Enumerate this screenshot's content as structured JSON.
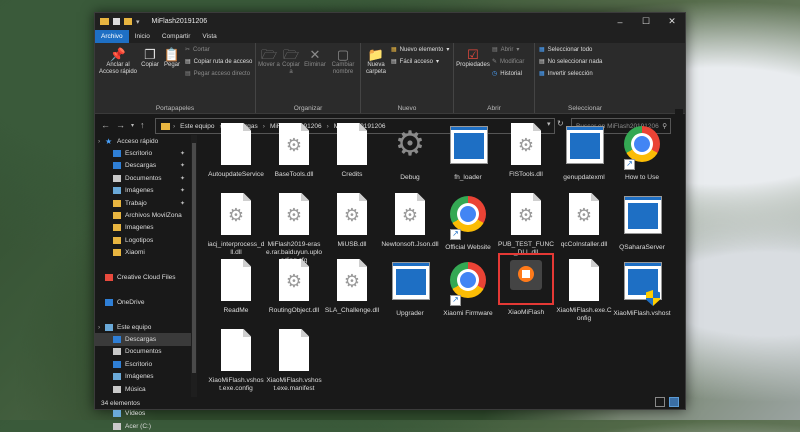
{
  "window": {
    "title": "MiFlash20191206"
  },
  "tabs": [
    "Archivo",
    "Inicio",
    "Compartir",
    "Vista"
  ],
  "ribbon": {
    "portapapeles": {
      "label": "Portapapeles",
      "anclar": "Anclar al Acceso rápido",
      "copiar": "Copiar",
      "pegar": "Pegar",
      "cortar": "Cortar",
      "copiar_ruta": "Copiar ruta de acceso",
      "pegar_acceso": "Pegar acceso directo"
    },
    "organizar": {
      "label": "Organizar",
      "mover": "Mover a",
      "copiar_a": "Copiar a",
      "eliminar": "Eliminar",
      "cambiar_nombre": "Cambiar nombre"
    },
    "nuevo": {
      "label": "Nuevo",
      "nueva_carpeta": "Nueva carpeta",
      "nuevo_elemento": "Nuevo elemento",
      "facil_acceso": "Fácil acceso"
    },
    "abrir": {
      "label": "Abrir",
      "propiedades": "Propiedades",
      "abrir": "Abrir",
      "modificar": "Modificar",
      "historial": "Historial"
    },
    "seleccionar": {
      "label": "Seleccionar",
      "todo": "Seleccionar todo",
      "nada": "No seleccionar nada",
      "invertir": "Invertir selección"
    }
  },
  "address": {
    "path": [
      "Este equipo",
      "Descargas",
      "MiFlash20191206",
      "MiFlash20191206"
    ],
    "search_placeholder": "Buscar en MiFlash20191206"
  },
  "sidebar": [
    {
      "label": "Acceso rápido",
      "icon": "star-icon",
      "color": "#4aa3ff",
      "pin": false
    },
    {
      "label": "Escritorio",
      "icon": "desktop-icon",
      "color": "#2f7fd6",
      "pin": true
    },
    {
      "label": "Descargas",
      "icon": "download-icon",
      "color": "#2f7fd6",
      "pin": true
    },
    {
      "label": "Documentos",
      "icon": "document-icon",
      "color": "#c9c9c9",
      "pin": true
    },
    {
      "label": "Imágenes",
      "icon": "image-icon",
      "color": "#6aa9d8",
      "pin": true
    },
    {
      "label": "Trabajo",
      "icon": "folder-icon",
      "color": "#e8b540",
      "pin": true
    },
    {
      "label": "Archivos MovilZona",
      "icon": "folder-icon",
      "color": "#e8b540",
      "pin": false
    },
    {
      "label": "Imagenes",
      "icon": "folder-icon",
      "color": "#e8b540",
      "pin": false
    },
    {
      "label": "Logotipos",
      "icon": "folder-icon",
      "color": "#e8b540",
      "pin": false
    },
    {
      "label": "Xiaomi",
      "icon": "folder-icon",
      "color": "#e8b540",
      "pin": false
    },
    {
      "label": "",
      "icon": "",
      "color": "",
      "pin": false
    },
    {
      "label": "Creative Cloud Files",
      "icon": "cloud-icon",
      "color": "#e84a3d",
      "pin": false
    },
    {
      "label": "",
      "icon": "",
      "color": "",
      "pin": false
    },
    {
      "label": "OneDrive",
      "icon": "onedrive-icon",
      "color": "#2f7fd6",
      "pin": false
    },
    {
      "label": "",
      "icon": "",
      "color": "",
      "pin": false
    },
    {
      "label": "Este equipo",
      "icon": "pc-icon",
      "color": "#6aa9d8",
      "pin": false
    },
    {
      "label": "Descargas",
      "icon": "download-icon",
      "color": "#2f7fd6",
      "pin": false,
      "selected": true
    },
    {
      "label": "Documentos",
      "icon": "document-icon",
      "color": "#c9c9c9",
      "pin": false
    },
    {
      "label": "Escritorio",
      "icon": "desktop-icon",
      "color": "#2f7fd6",
      "pin": false
    },
    {
      "label": "Imágenes",
      "icon": "image-icon",
      "color": "#6aa9d8",
      "pin": false
    },
    {
      "label": "Música",
      "icon": "music-icon",
      "color": "#c9c9c9",
      "pin": false
    },
    {
      "label": "Objetos 3D",
      "icon": "cube-icon",
      "color": "#6aa9d8",
      "pin": false
    },
    {
      "label": "Vídeos",
      "icon": "video-icon",
      "color": "#6aa9d8",
      "pin": false
    },
    {
      "label": "Acer (C:)",
      "icon": "drive-icon",
      "color": "#c9c9c9",
      "pin": false
    }
  ],
  "files": [
    {
      "name": "AutoupdateService",
      "type": "doc"
    },
    {
      "name": "BaseTools.dll",
      "type": "dll"
    },
    {
      "name": "Credits",
      "type": "doc"
    },
    {
      "name": "Debug",
      "type": "gear"
    },
    {
      "name": "fh_loader",
      "type": "exe"
    },
    {
      "name": "FlSTools.dll",
      "type": "dll"
    },
    {
      "name": "genupdatexml",
      "type": "exe"
    },
    {
      "name": "How to Use",
      "type": "chrome"
    },
    {
      "name": "iacj_interprocess_dll.dll",
      "type": "dll"
    },
    {
      "name": "MiFlash2019-erase.rar.baiduyun.uploading.cfg",
      "type": "dll"
    },
    {
      "name": "MiUSB.dll",
      "type": "dll"
    },
    {
      "name": "Newtonsoft.Json.dll",
      "type": "dll"
    },
    {
      "name": "Official Website",
      "type": "chrome"
    },
    {
      "name": "PUB_TEST_FUNC_DLL.dll",
      "type": "dll"
    },
    {
      "name": "qcCoInstaller.dll",
      "type": "dll"
    },
    {
      "name": "QSaharaServer",
      "type": "exe"
    },
    {
      "name": "ReadMe",
      "type": "doc"
    },
    {
      "name": "RoutingObject.dll",
      "type": "dll"
    },
    {
      "name": "SLA_Challenge.dll",
      "type": "dll"
    },
    {
      "name": "Upgrader",
      "type": "exe"
    },
    {
      "name": "Xiaomi Firmware",
      "type": "chrome"
    },
    {
      "name": "XiaoMiFlash",
      "type": "miflash",
      "highlighted": true
    },
    {
      "name": "XiaoMiFlash.exe.Config",
      "type": "doc"
    },
    {
      "name": "XiaoMiFlash.vshost",
      "type": "shield"
    },
    {
      "name": "XiaoMiFlash.vshost.exe.config",
      "type": "doc"
    },
    {
      "name": "XiaoMiFlash.vshost.exe.manifest",
      "type": "doc"
    }
  ],
  "status": {
    "count": "34 elementos"
  }
}
